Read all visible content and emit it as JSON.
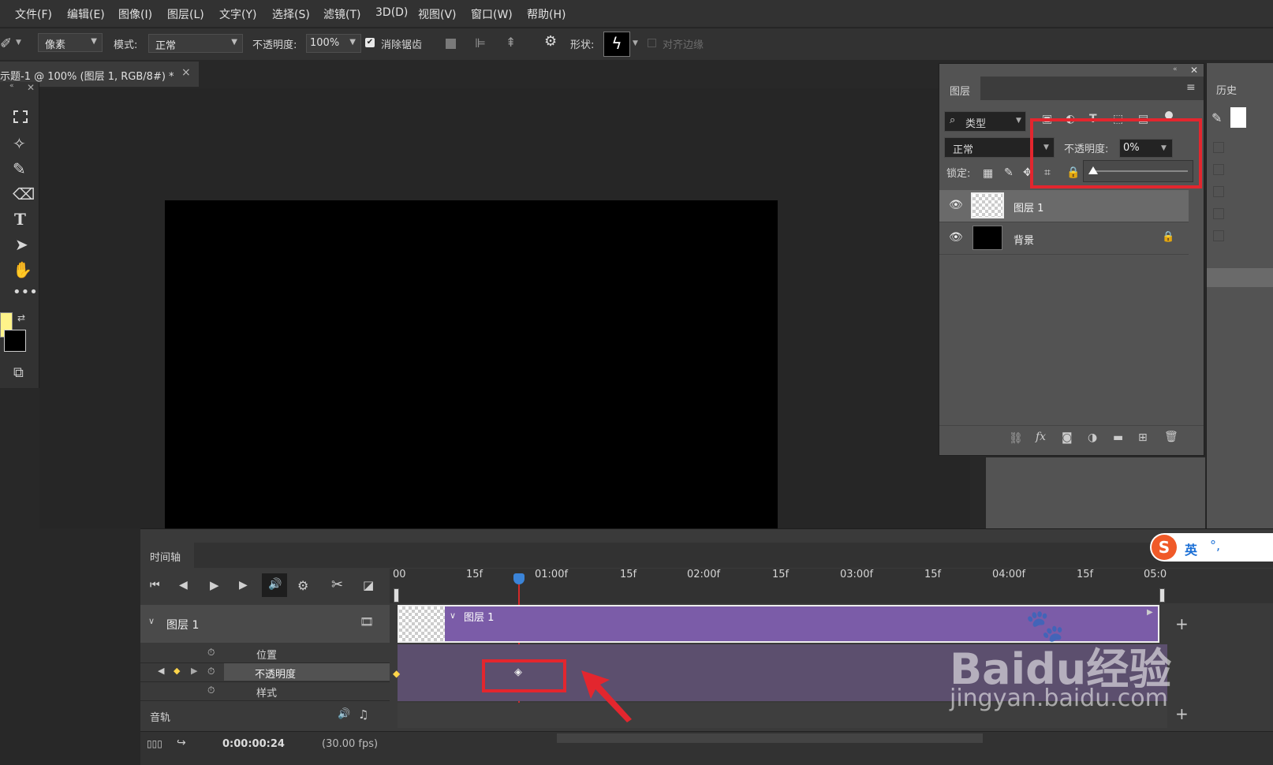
{
  "menu": [
    "文件(F)",
    "编辑(E)",
    "图像(I)",
    "图层(L)",
    "文字(Y)",
    "选择(S)",
    "滤镜(T)",
    "3D(D)",
    "视图(V)",
    "窗口(W)",
    "帮助(H)"
  ],
  "options": {
    "pixels": "像素",
    "mode_label": "模式:",
    "mode_value": "正常",
    "opacity_label": "不透明度:",
    "opacity_value": "100%",
    "antialias_label": "消除锯齿",
    "shape_label": "形状:",
    "align_edges_label": "对齐边缘"
  },
  "document_tab": {
    "title": "示题-1 @ 100% (图层 1, RGB/8#) *",
    "close": "×"
  },
  "colors": {
    "foreground": "#fff48a",
    "background": "#000000",
    "highlight_box": "#e3262e",
    "clip_purple": "#7b5ca8",
    "playhead": "#d22a2a"
  },
  "layers_panel": {
    "title": "图层",
    "filter_label": "类型",
    "blend_mode": "正常",
    "opacity_label": "不透明度:",
    "opacity_value": "0%",
    "opacity_slider_fraction": 0.0,
    "lock_label": "锁定:",
    "layers": [
      {
        "name": "图层 1",
        "selected": true,
        "locked": false
      },
      {
        "name": "背景",
        "selected": false,
        "locked": true
      }
    ]
  },
  "history_panel": {
    "title": "历史"
  },
  "timeline": {
    "title": "时间轴",
    "ruler": [
      "00",
      "15f",
      "01:00f",
      "15f",
      "02:00f",
      "15f",
      "03:00f",
      "15f",
      "04:00f",
      "15f",
      "05:0"
    ],
    "track_name": "图层 1",
    "clip_label": "图层 1",
    "properties": [
      "位置",
      "不透明度",
      "样式"
    ],
    "audio_label": "音轨",
    "current_time": "0:00:00:24",
    "fps": "(30.00 fps)"
  },
  "ime": {
    "lang": "英",
    "punct": "°,"
  },
  "watermark": {
    "logo_text": "Baidu经验",
    "url": "jingyan.baidu.com"
  }
}
